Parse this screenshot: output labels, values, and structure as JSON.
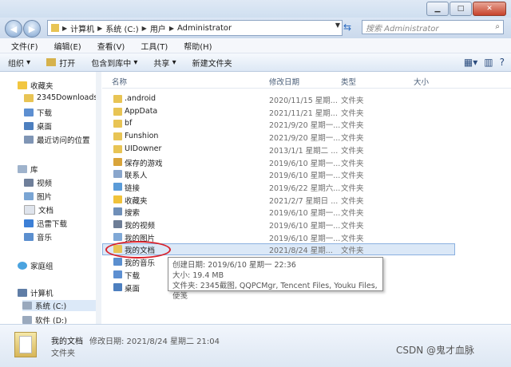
{
  "address": {
    "segments": [
      "计算机",
      "系统 (C:)",
      "用户",
      "Administrator"
    ]
  },
  "search": {
    "placeholder": "搜索 Administrator"
  },
  "menu": [
    "文件(F)",
    "编辑(E)",
    "查看(V)",
    "工具(T)",
    "帮助(H)"
  ],
  "toolbar": {
    "organize": "组织",
    "open": "打开",
    "include_library": "包含到库中",
    "share": "共享",
    "new_folder": "新建文件夹"
  },
  "nav": {
    "favorites": "收藏夹",
    "fav_items": [
      "2345Downloads",
      "下载",
      "桌面",
      "最近访问的位置"
    ],
    "libraries": "库",
    "lib_items": [
      "视频",
      "图片",
      "文档",
      "迅雷下载",
      "音乐"
    ],
    "homegroup": "家庭组",
    "computer": "计算机",
    "drives": [
      "系统 (C:)",
      "软件 (D:)"
    ]
  },
  "columns": {
    "name": "名称",
    "modified": "修改日期",
    "type": "类型",
    "size": "大小"
  },
  "files": [
    {
      "name": ".android",
      "date": "2020/11/15 星期...",
      "type": "文件夹",
      "icon": "folder"
    },
    {
      "name": "AppData",
      "date": "2021/11/21 星期...",
      "type": "文件夹",
      "icon": "folder"
    },
    {
      "name": "bf",
      "date": "2021/9/20 星期一...",
      "type": "文件夹",
      "icon": "folder"
    },
    {
      "name": "Funshion",
      "date": "2021/9/20 星期一...",
      "type": "文件夹",
      "icon": "folder"
    },
    {
      "name": "UIDowner",
      "date": "2013/1/1 星期二 ...",
      "type": "文件夹",
      "icon": "folder"
    },
    {
      "name": "保存的游戏",
      "date": "2019/6/10 星期一...",
      "type": "文件夹",
      "icon": "games"
    },
    {
      "name": "联系人",
      "date": "2019/6/10 星期一...",
      "type": "文件夹",
      "icon": "contacts"
    },
    {
      "name": "链接",
      "date": "2019/6/22 星期六...",
      "type": "文件夹",
      "icon": "links"
    },
    {
      "name": "收藏夹",
      "date": "2021/2/7 星期日 ...",
      "type": "文件夹",
      "icon": "star"
    },
    {
      "name": "搜索",
      "date": "2019/6/10 星期一...",
      "type": "文件夹",
      "icon": "search"
    },
    {
      "name": "我的视频",
      "date": "2019/6/10 星期一...",
      "type": "文件夹",
      "icon": "video"
    },
    {
      "name": "我的图片",
      "date": "2019/6/10 星期一...",
      "type": "文件夹",
      "icon": "pictures"
    },
    {
      "name": "我的文档",
      "date": "2021/8/24 星期...",
      "type": "文件夹",
      "icon": "documents",
      "selected": true
    },
    {
      "name": "我的音乐",
      "date": "",
      "type": "",
      "icon": "music"
    },
    {
      "name": "下载",
      "date": "",
      "type": "",
      "icon": "download"
    },
    {
      "name": "桌面",
      "date": "",
      "type": "",
      "icon": "desktop"
    }
  ],
  "tooltip": {
    "created": "创建日期: 2019/6/10 星期一 22:36",
    "size": "大小: 19.4 MB",
    "files": "文件夹: 2345截图, QQPCMgr, Tencent Files, Youku Files, 便笺"
  },
  "details": {
    "name": "我的文档",
    "modified": "修改日期: 2021/8/24 星期二 21:04",
    "type": "文件夹"
  },
  "watermark": "CSDN @鬼才血脉"
}
